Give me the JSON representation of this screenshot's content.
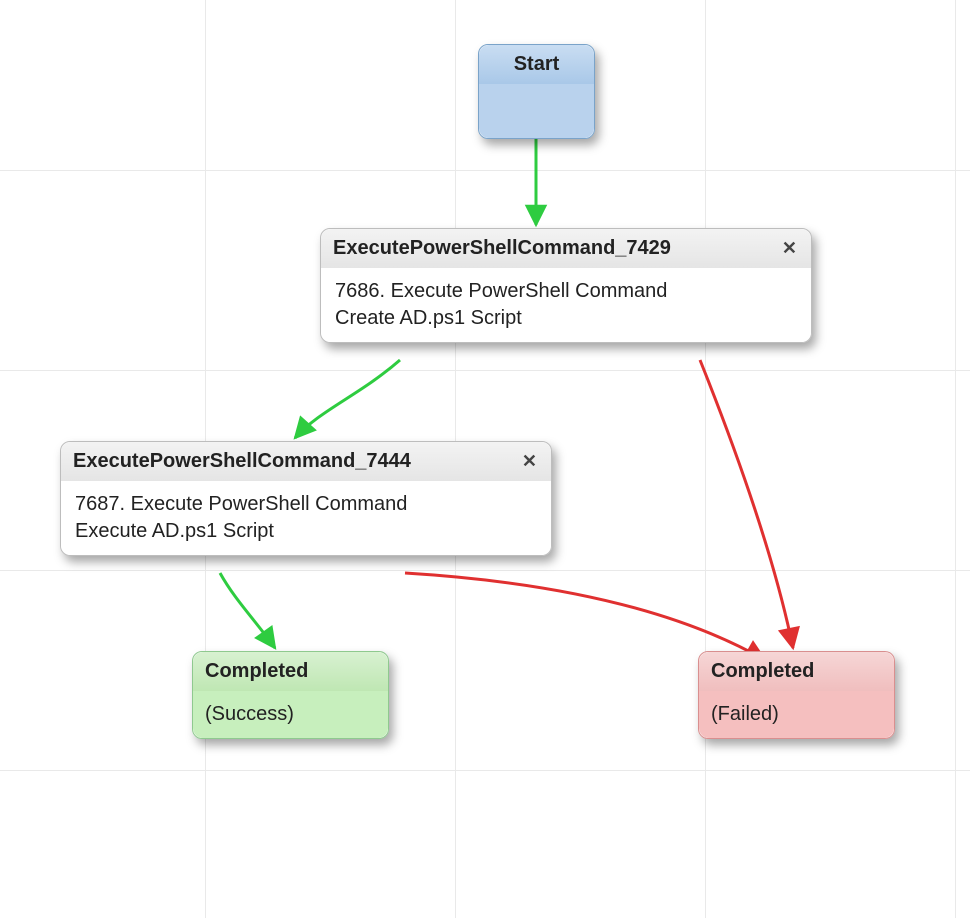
{
  "nodes": {
    "start": {
      "title": "Start"
    },
    "ps1": {
      "title": "ExecutePowerShellCommand_7429",
      "line1": "7686. Execute PowerShell Command",
      "line2": "Create AD.ps1 Script",
      "close": "✕"
    },
    "ps2": {
      "title": "ExecutePowerShellCommand_7444",
      "line1": "7687. Execute PowerShell Command",
      "line2": "Execute AD.ps1 Script",
      "close": "✕"
    },
    "success": {
      "title": "Completed",
      "status": "(Success)"
    },
    "failed": {
      "title": "Completed",
      "status": "(Failed)"
    }
  },
  "edges": [
    {
      "from": "start",
      "to": "ps1",
      "color": "success"
    },
    {
      "from": "ps1",
      "to": "ps2",
      "color": "success"
    },
    {
      "from": "ps2",
      "to": "success",
      "color": "success"
    },
    {
      "from": "ps1",
      "to": "failed",
      "color": "failure"
    },
    {
      "from": "ps2",
      "to": "failed",
      "color": "failure"
    }
  ],
  "colors": {
    "success_edge": "#2ecc40",
    "failure_edge": "#e03030"
  }
}
